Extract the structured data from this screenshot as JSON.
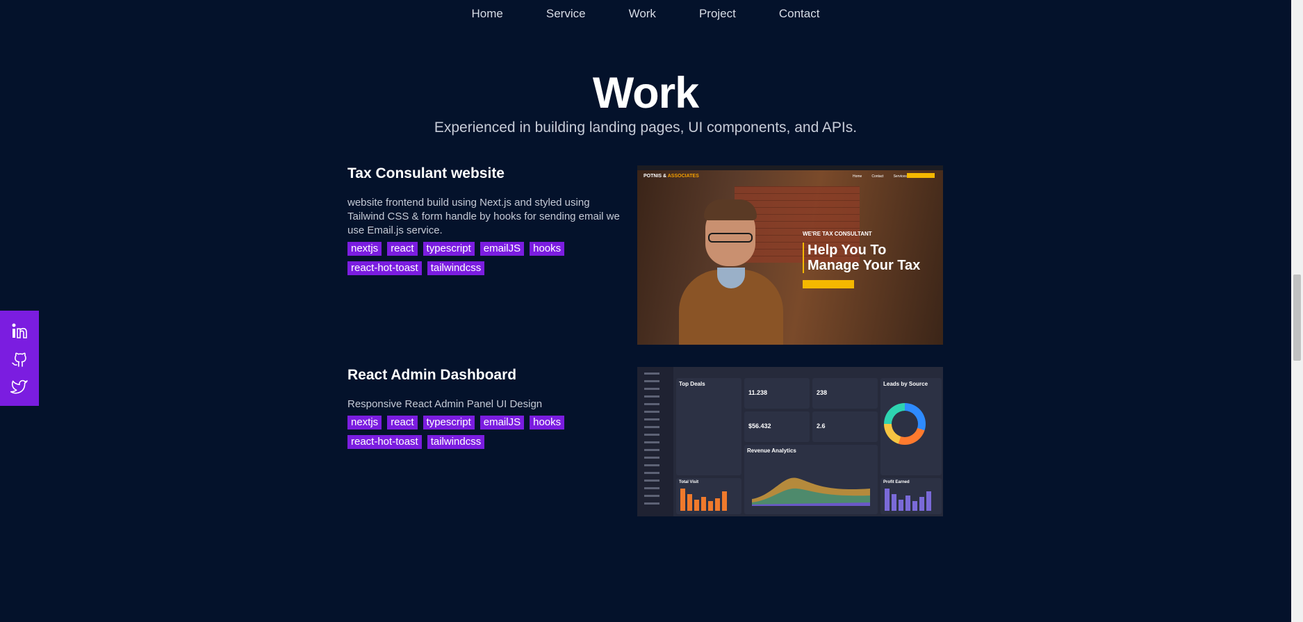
{
  "nav": [
    "Home",
    "Service",
    "Work",
    "Project",
    "Contact"
  ],
  "section": {
    "title": "Work",
    "subtitle": "Experienced in building landing pages, UI components, and APIs."
  },
  "projects": [
    {
      "title": "Tax Consulant website",
      "description": "website frontend build using Next.js and styled using Tailwind CSS & form handle by hooks for sending email we use Email.js service.",
      "tags": [
        "nextjs",
        "react",
        "typescript",
        "emailJS",
        "hooks",
        "react-hot-toast",
        "tailwindcss"
      ],
      "thumb": {
        "logo_a": "POTNIS & ",
        "logo_b": "ASSOCIATES",
        "nav": [
          "Home",
          "Contact",
          "Services"
        ],
        "eyebrow": "WE'RE TAX CONSULTANT",
        "headline": "Help You To Manage Your Tax"
      }
    },
    {
      "title": "React Admin Dashboard",
      "description": "Responsive React Admin Panel UI Design",
      "tags": [
        "nextjs",
        "react",
        "typescript",
        "emailJS",
        "hooks",
        "react-hot-toast",
        "tailwindcss"
      ],
      "thumb": {
        "top_deals": "Top Deals",
        "kpi_1": "11.238",
        "kpi_2": "238",
        "kpi_3": "$56.432",
        "kpi_4": "2.6",
        "leads": "Leads by Source",
        "revenue": "Revenue Analytics",
        "total_visit": "Total Visit",
        "profit": "Profit Earned"
      }
    }
  ],
  "social": [
    "linkedin-icon",
    "github-icon",
    "twitter-icon"
  ],
  "colors": {
    "background": "#04122b",
    "accent": "#7b1de0"
  }
}
